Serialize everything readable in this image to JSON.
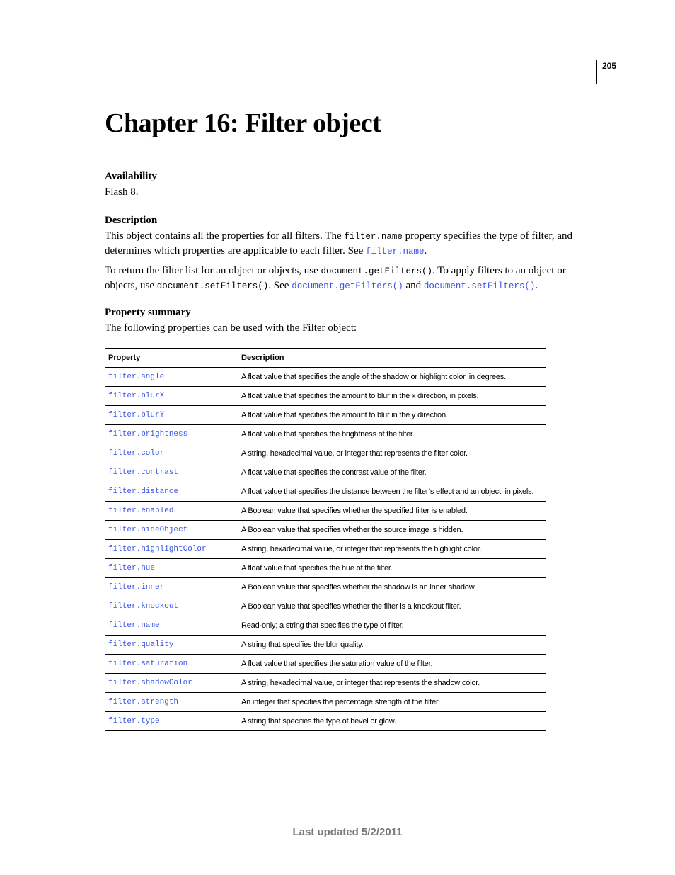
{
  "page_number": "205",
  "chapter_title": "Chapter 16: Filter object",
  "availability": {
    "heading": "Availability",
    "text": "Flash 8."
  },
  "description": {
    "heading": "Description",
    "p1": {
      "t1": "This object contains all the properties for all filters. The ",
      "code1": "filter.name",
      "t2": " property specifies the type of filter, and determines which properties are applicable to each filter. See ",
      "link1": "filter.name",
      "t3": "."
    },
    "p2": {
      "t1": "To return the filter list for an object or objects, use ",
      "code1": "document.getFilters()",
      "t2": ". To apply filters to an object or objects, use ",
      "code2": "document.setFilters()",
      "t3": ". See ",
      "link1": "document.getFilters()",
      "t4": " and ",
      "link2": "document.setFilters()",
      "t5": "."
    }
  },
  "property_summary": {
    "heading": "Property summary",
    "intro": "The following properties can be used with the Filter object:",
    "columns": [
      "Property",
      "Description"
    ],
    "rows": [
      {
        "property": "filter.angle",
        "description": "A float value that specifies the angle of the shadow or highlight color, in degrees."
      },
      {
        "property": "filter.blurX",
        "description": "A float value that specifies the amount to blur in the x direction, in pixels."
      },
      {
        "property": "filter.blurY",
        "description": "A float value that specifies the amount to blur in the y direction."
      },
      {
        "property": "filter.brightness",
        "description": "A float value that specifies the brightness of the filter."
      },
      {
        "property": "filter.color",
        "description": "A string, hexadecimal value, or integer that represents the filter color."
      },
      {
        "property": "filter.contrast",
        "description": "A float value that specifies the contrast value of the filter."
      },
      {
        "property": "filter.distance",
        "description": "A float value that specifies the distance between the filter’s effect and an object, in pixels."
      },
      {
        "property": "filter.enabled",
        "description": "A Boolean value that specifies whether the specified filter is enabled."
      },
      {
        "property": "filter.hideObject",
        "description": "A Boolean value that specifies whether the source image is hidden."
      },
      {
        "property": "filter.highlightColor",
        "description": "A string, hexadecimal value, or integer that represents the highlight color."
      },
      {
        "property": "filter.hue",
        "description": "A float value that specifies the hue of the filter."
      },
      {
        "property": "filter.inner",
        "description": "A Boolean value that specifies whether the shadow is an inner shadow."
      },
      {
        "property": "filter.knockout",
        "description": "A Boolean value that specifies whether the filter is a knockout filter."
      },
      {
        "property": "filter.name",
        "description": "Read-only; a string that specifies the type of filter."
      },
      {
        "property": "filter.quality",
        "description": "A string that specifies the blur quality."
      },
      {
        "property": "filter.saturation",
        "description": "A float value that specifies the saturation value of the filter."
      },
      {
        "property": "filter.shadowColor",
        "description": "A string, hexadecimal value, or integer that represents the shadow color."
      },
      {
        "property": "filter.strength",
        "description": "An integer that specifies the percentage strength of the filter."
      },
      {
        "property": "filter.type",
        "description": "A string that specifies the type of bevel or glow."
      }
    ]
  },
  "footer": "Last updated 5/2/2011",
  "colors": {
    "link": "#3b55e6",
    "footer_text": "#7a7a7a"
  }
}
